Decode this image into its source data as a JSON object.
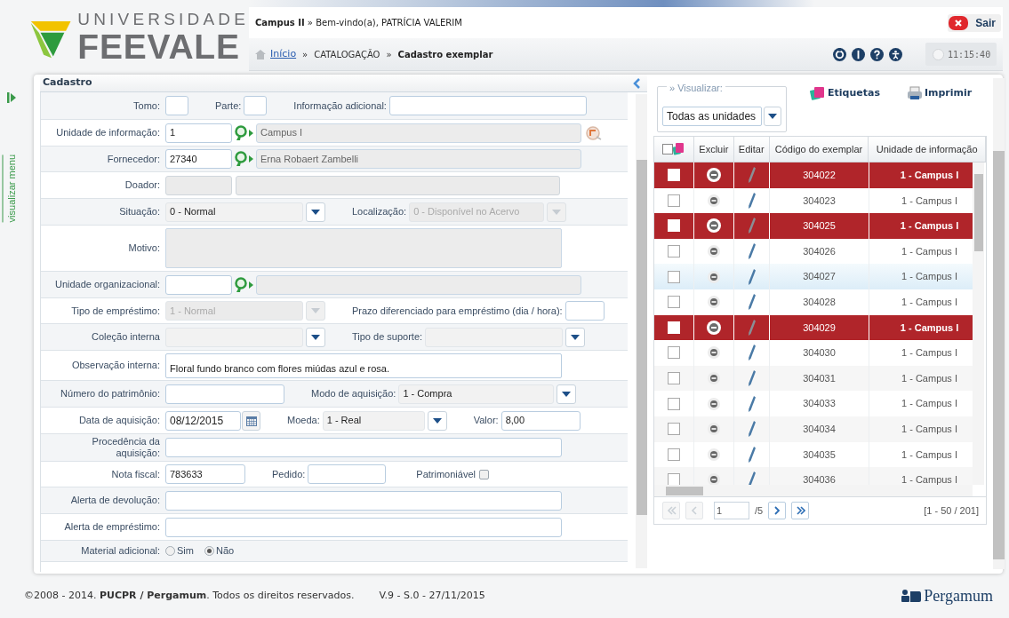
{
  "header": {
    "logo": {
      "line1": "UNIVERSIDADE",
      "line2": "FEEVALE"
    },
    "welcome": "**Campus II** » Bem-vindo(a), PATRÍCIA VALERIM",
    "breadcrumb": [
      {
        "kind": "link",
        "label": "Início"
      },
      {
        "kind": "sep",
        "label": "»"
      },
      {
        "kind": "plain",
        "label": "CATALOGAÇÃO"
      },
      {
        "kind": "sep",
        "label": "»"
      },
      {
        "kind": "current",
        "label": "Cadastro exemplar"
      }
    ],
    "clock": "11:15:40",
    "logout": "Sair"
  },
  "side_menu": {
    "label": "visualizar menu"
  },
  "form": {
    "title": "Cadastro",
    "rows": [
      {
        "label": "Tomo:",
        "fields": [
          {
            "kind": "text",
            "disabled": false
          },
          {
            "kind": "text",
            "label": "Parte:",
            "disabled": false
          },
          {
            "kind": "text",
            "label": "Informação adicional:",
            "disabled": false
          }
        ]
      },
      {
        "label": "Unidade de informação:",
        "fields": [
          {
            "kind": "lookup",
            "value": "1",
            "name": "Campus I"
          },
          {
            "kind": "clear_button"
          }
        ]
      },
      {
        "label": "Fornecedor:",
        "fields": [
          {
            "kind": "lookup",
            "value": "27340",
            "name": "Erna Robaert Zambelli"
          }
        ]
      },
      {
        "label": "Doador:",
        "fields": [
          {
            "kind": "text",
            "disabled": true
          },
          {
            "kind": "text",
            "disabled": true
          }
        ]
      },
      {
        "label": "Situação:",
        "fields": [
          {
            "kind": "select",
            "value": "0 - Normal",
            "disabled": false
          },
          {
            "kind": "select",
            "label": "Localização:",
            "value": "0 - Disponível no Acervo",
            "disabled": true
          }
        ]
      },
      {
        "label": "Motivo:",
        "fields": [
          {
            "kind": "textarea",
            "disabled": true
          }
        ]
      },
      {
        "label": "Unidade organizacional:",
        "fields": [
          {
            "kind": "lookup"
          }
        ]
      },
      {
        "label": "Tipo de empréstimo:",
        "fields": [
          {
            "kind": "select",
            "value": "1 - Normal",
            "disabled": true
          },
          {
            "kind": "text",
            "label": "Prazo diferenciado para empréstimo (dia / hora):",
            "disabled": false
          }
        ]
      },
      {
        "label": "Coleção interna",
        "fields": [
          {
            "kind": "select",
            "disabled": false
          },
          {
            "kind": "select",
            "label": "Tipo de suporte:",
            "disabled": false
          }
        ]
      },
      {
        "label": "Observação interna:",
        "fields": [
          {
            "kind": "textarea",
            "value": "Floral fundo branco com flores miúdas azul e rosa.",
            "disabled": false
          }
        ]
      },
      {
        "label": "Número do patrimônio:",
        "fields": [
          {
            "kind": "text",
            "disabled": false
          },
          {
            "kind": "select",
            "label": "Modo de aquisição:",
            "value": "1 - Compra",
            "disabled": false
          }
        ]
      },
      {
        "label": "Data de aquisição:",
        "fields": [
          {
            "kind": "date",
            "value": "08/12/2015"
          },
          {
            "kind": "select",
            "label": "Moeda:",
            "value": "1 - Real",
            "disabled": false
          },
          {
            "kind": "text",
            "label": "Valor:",
            "value": "8,00",
            "disabled": false
          }
        ]
      },
      {
        "label": "Procedência da aquisição:",
        "fields": [
          {
            "kind": "text",
            "disabled": false
          }
        ]
      },
      {
        "label": "Nota fiscal:",
        "fields": [
          {
            "kind": "text",
            "value": "783633",
            "disabled": false
          },
          {
            "kind": "text",
            "label": "Pedido:",
            "disabled": false
          },
          {
            "kind": "checkbox",
            "label": "Patrimoniável",
            "checked": false
          }
        ]
      },
      {
        "label": "Alerta de devolução:",
        "fields": [
          {
            "kind": "text",
            "disabled": false
          }
        ]
      },
      {
        "label": "Alerta de empréstimo:",
        "fields": [
          {
            "kind": "text",
            "disabled": false
          }
        ]
      },
      {
        "label": "Material adicional:",
        "fields": [
          {
            "kind": "radio",
            "options": [
              {
                "label": "Sim",
                "selected": false
              },
              {
                "label": "Não",
                "selected": true
              }
            ]
          }
        ]
      }
    ]
  },
  "items": {
    "view": {
      "legend": "» Visualizar:",
      "value": "Todas as unidades"
    },
    "actions": [
      {
        "kind": "labels",
        "label": "Etiquetas"
      },
      {
        "kind": "print",
        "label": "Imprimir"
      }
    ],
    "table": {
      "all_checked": false,
      "columns": [
        "Excluir",
        "Editar",
        "Código do exemplar",
        "Unidade de informação"
      ],
      "rows": [
        {
          "checked": false,
          "selected": true,
          "highlighted": false,
          "code": "304022",
          "unit": "1 - Campus I"
        },
        {
          "checked": false,
          "selected": false,
          "highlighted": false,
          "code": "304023",
          "unit": "1 - Campus I"
        },
        {
          "checked": false,
          "selected": true,
          "highlighted": false,
          "code": "304025",
          "unit": "1 - Campus I"
        },
        {
          "checked": false,
          "selected": false,
          "highlighted": false,
          "code": "304026",
          "unit": "1 - Campus I"
        },
        {
          "checked": false,
          "selected": false,
          "highlighted": true,
          "code": "304027",
          "unit": "1 - Campus I"
        },
        {
          "checked": false,
          "selected": false,
          "highlighted": false,
          "code": "304028",
          "unit": "1 - Campus I"
        },
        {
          "checked": false,
          "selected": true,
          "highlighted": false,
          "code": "304029",
          "unit": "1 - Campus I"
        },
        {
          "checked": false,
          "selected": false,
          "highlighted": false,
          "code": "304030",
          "unit": "1 - Campus I"
        },
        {
          "checked": false,
          "selected": false,
          "highlighted": false,
          "code": "304031",
          "unit": "1 - Campus I"
        },
        {
          "checked": false,
          "selected": false,
          "highlighted": false,
          "code": "304033",
          "unit": "1 - Campus I"
        },
        {
          "checked": false,
          "selected": false,
          "highlighted": false,
          "code": "304034",
          "unit": "1 - Campus I"
        },
        {
          "checked": false,
          "selected": false,
          "highlighted": false,
          "code": "304035",
          "unit": "1 - Campus I"
        },
        {
          "checked": false,
          "selected": false,
          "highlighted": false,
          "code": "304036",
          "unit": "1 - Campus I"
        }
      ]
    },
    "pagination": {
      "nav": [
        {
          "kind": "first",
          "disabled": true
        },
        {
          "kind": "prev",
          "disabled": true
        },
        {
          "kind": "next",
          "disabled": false
        },
        {
          "kind": "last",
          "disabled": false
        }
      ],
      "page": "1",
      "pages": "/5",
      "range": "[1 - 50 / 201]"
    }
  },
  "footer": {
    "copyright": "©2008 - 2014. **PUCPR / Pergamum**. Todos os direitos reservados.",
    "version": "V.9 - S.0 - 27/11/2015",
    "brand": "Pergamum"
  }
}
